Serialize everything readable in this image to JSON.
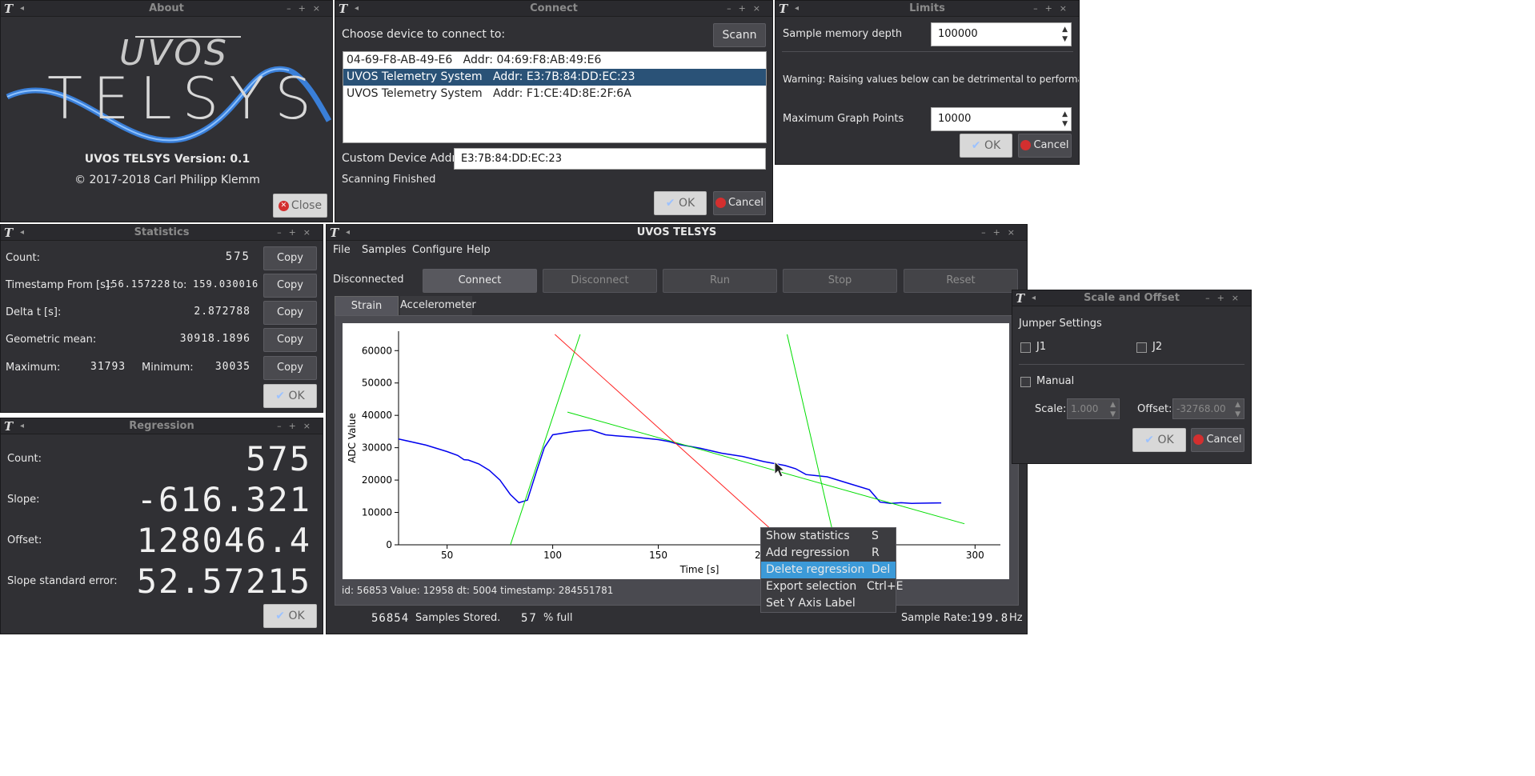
{
  "about": {
    "title": "About",
    "logo_top": "UVOS",
    "logo_main": "TELSYS",
    "version": "UVOS TELSYS Version: 0.1",
    "copyright": "© 2017-2018 Carl Philipp Klemm",
    "close_label": "Close"
  },
  "connect": {
    "title": "Connect",
    "prompt": "Choose device to connect to:",
    "scan_label": "Scann",
    "devices": [
      {
        "name": "04-69-F8-AB-49-E6",
        "addr": "Addr: 04:69:F8:AB:49:E6"
      },
      {
        "name": "UVOS Telemetry System",
        "addr": "Addr: E3:7B:84:DD:EC:23"
      },
      {
        "name": "UVOS Telemetry System",
        "addr": "Addr: F1:CE:4D:8E:2F:6A"
      }
    ],
    "custom_label": "Custom Device Address:",
    "custom_value": "E3:7B:84:DD:EC:23",
    "status": "Scanning Finished",
    "ok_label": "OK",
    "cancel_label": "Cancel"
  },
  "limits": {
    "title": "Limits",
    "mem_label": "Sample memory depth",
    "mem_value": "100000",
    "warning": "Warning: Raising values below can be detrimental to performance.",
    "points_label": "Maximum Graph Points",
    "points_value": "10000",
    "ok_label": "OK",
    "cancel_label": "Cancel"
  },
  "statistics": {
    "title": "Statistics",
    "count_label": "Count:",
    "count_value": "575",
    "ts_label": "Timestamp From [s]:",
    "ts_from": "156.157228",
    "ts_to_label": "to:",
    "ts_to": "159.030016",
    "delta_label": "Delta t [s]:",
    "delta_value": "2.872788",
    "geo_label": "Geometric mean:",
    "geo_value": "30918.1896",
    "max_label": "Maximum:",
    "max_value": "31793",
    "min_label": "Minimum:",
    "min_value": "30035",
    "copy_label": "Copy",
    "ok_label": "OK"
  },
  "regression": {
    "title": "Regression",
    "count_label": "Count:",
    "count_value": "575",
    "slope_label": "Slope:",
    "slope_value": "-616.321",
    "offset_label": "Offset:",
    "offset_value": "128046.4",
    "se_label": "Slope standard error:",
    "se_value": "52.57215",
    "ok_label": "OK"
  },
  "main": {
    "title": "UVOS TELSYS",
    "menu": [
      "File",
      "Samples",
      "Configure",
      "Help"
    ],
    "status": "Disconnected",
    "buttons": [
      "Connect",
      "Disconnect",
      "Run",
      "Stop",
      "Reset"
    ],
    "tabs": [
      "Strain Guage",
      "Accelerometer"
    ],
    "info_line": "id: 56853  Value: 12958  dt: 5004  timestamp: 284551781",
    "samples_value": "56854",
    "samples_label": "Samples Stored.",
    "full_value": "57",
    "full_label": "% full",
    "rate_label": "Sample Rate:",
    "rate_value": "199.8",
    "rate_unit": "Hz"
  },
  "context_menu": {
    "items": [
      {
        "label": "Show statistics",
        "shortcut": "S"
      },
      {
        "label": "Add regression",
        "shortcut": "R"
      },
      {
        "label": "Delete regression",
        "shortcut": "Del"
      },
      {
        "label": "Export selection",
        "shortcut": "Ctrl+E"
      },
      {
        "label": "Set Y Axis Label",
        "shortcut": ""
      }
    ],
    "selected_index": 2
  },
  "scale_offset": {
    "title": "Scale and Offset",
    "jumper_label": "Jumper Settings",
    "j1_label": "J1",
    "j2_label": "J2",
    "manual_label": "Manual",
    "scale_label": "Scale:",
    "scale_value": "1.000",
    "offset_label": "Offset:",
    "offset_value": "-32768.00",
    "ok_label": "OK",
    "cancel_label": "Cancel"
  },
  "chart_data": {
    "type": "line",
    "xlabel": "Time [s]",
    "ylabel": "ADC Value",
    "xlim": [
      27,
      312
    ],
    "ylim": [
      0,
      66000
    ],
    "xticks": [
      50,
      100,
      150,
      200,
      300
    ],
    "yticks": [
      0,
      10000,
      20000,
      30000,
      40000,
      50000,
      60000
    ],
    "series": [
      {
        "color": "#0000ee",
        "x": [
          27,
          40,
          50,
          55,
          58,
          60,
          65,
          70,
          75,
          80,
          84,
          88,
          92,
          96,
          100,
          105,
          110,
          118,
          125,
          130,
          140,
          150,
          155,
          160,
          170,
          180,
          190,
          200,
          210,
          215,
          220,
          230,
          240,
          250,
          255,
          260,
          265,
          270,
          280,
          284
        ],
        "y": [
          32700,
          30800,
          28800,
          27600,
          26300,
          26200,
          25000,
          23000,
          20000,
          15500,
          13000,
          13800,
          22000,
          30000,
          34000,
          34500,
          35000,
          35500,
          34000,
          33700,
          33200,
          32500,
          31900,
          31000,
          29800,
          28300,
          27300,
          25700,
          24500,
          23500,
          21700,
          21000,
          19000,
          17000,
          13200,
          12800,
          13000,
          12800,
          12900,
          12958
        ]
      },
      {
        "color": "#00dd00",
        "x": [
          107,
          295
        ],
        "y": [
          41000,
          6500
        ]
      },
      {
        "color": "#00dd00",
        "x": [
          80,
          113
        ],
        "y": [
          0,
          65000
        ]
      },
      {
        "color": "#00dd00",
        "x": [
          211,
          234
        ],
        "y": [
          65000,
          0
        ]
      },
      {
        "color": "#ff2222",
        "x": [
          101,
          203
        ],
        "y": [
          65000,
          5000
        ]
      }
    ]
  }
}
